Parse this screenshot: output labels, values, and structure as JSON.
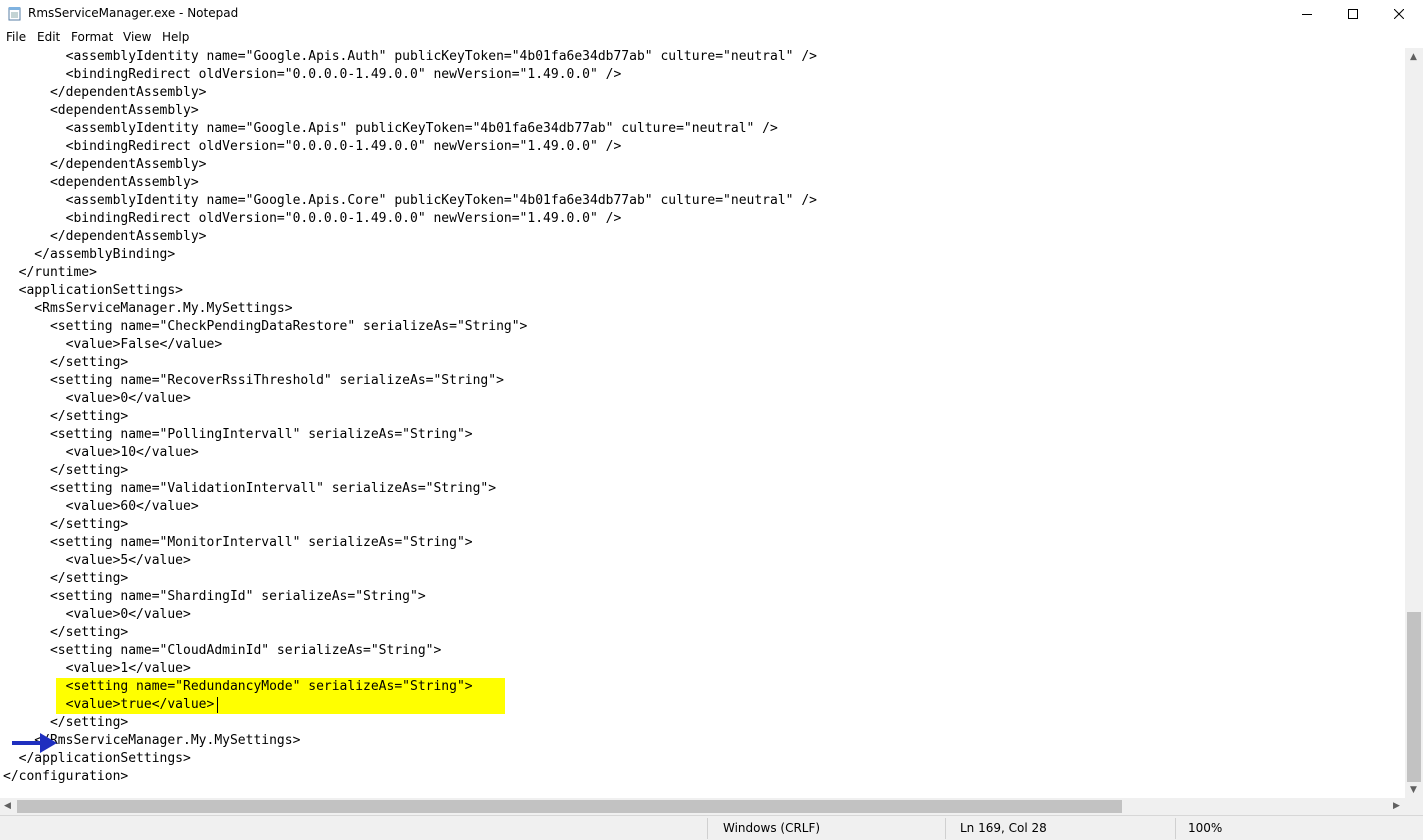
{
  "window": {
    "title": "RmsServiceManager.exe - Notepad",
    "controls": {
      "minimize": "minimize",
      "maximize": "maximize",
      "close": "close"
    }
  },
  "menu": [
    "File",
    "Edit",
    "Format",
    "View",
    "Help"
  ],
  "editor": {
    "lines": [
      "        <assemblyIdentity name=\"Google.Apis.Auth\" publicKeyToken=\"4b01fa6e34db77ab\" culture=\"neutral\" />",
      "        <bindingRedirect oldVersion=\"0.0.0.0-1.49.0.0\" newVersion=\"1.49.0.0\" />",
      "      </dependentAssembly>",
      "      <dependentAssembly>",
      "        <assemblyIdentity name=\"Google.Apis\" publicKeyToken=\"4b01fa6e34db77ab\" culture=\"neutral\" />",
      "        <bindingRedirect oldVersion=\"0.0.0.0-1.49.0.0\" newVersion=\"1.49.0.0\" />",
      "      </dependentAssembly>",
      "      <dependentAssembly>",
      "        <assemblyIdentity name=\"Google.Apis.Core\" publicKeyToken=\"4b01fa6e34db77ab\" culture=\"neutral\" />",
      "        <bindingRedirect oldVersion=\"0.0.0.0-1.49.0.0\" newVersion=\"1.49.0.0\" />",
      "      </dependentAssembly>",
      "    </assemblyBinding>",
      "  </runtime>",
      "  <applicationSettings>",
      "    <RmsServiceManager.My.MySettings>",
      "      <setting name=\"CheckPendingDataRestore\" serializeAs=\"String\">",
      "        <value>False</value>",
      "      </setting>",
      "      <setting name=\"RecoverRssiThreshold\" serializeAs=\"String\">",
      "        <value>0</value>",
      "      </setting>",
      "      <setting name=\"PollingIntervall\" serializeAs=\"String\">",
      "        <value>10</value>",
      "      </setting>",
      "      <setting name=\"ValidationIntervall\" serializeAs=\"String\">",
      "        <value>60</value>",
      "      </setting>",
      "      <setting name=\"MonitorIntervall\" serializeAs=\"String\">",
      "        <value>5</value>",
      "      </setting>",
      "      <setting name=\"ShardingId\" serializeAs=\"String\">",
      "        <value>0</value>",
      "      </setting>",
      "      <setting name=\"CloudAdminId\" serializeAs=\"String\">",
      "        <value>1</value>",
      "        <setting name=\"RedundancyMode\" serializeAs=\"String\">",
      "        <value>true</value>",
      "      </setting>",
      "    </RmsServiceManager.My.MySettings>",
      "  </applicationSettings>",
      "</configuration>"
    ],
    "highlight_color": "#ffff00",
    "arrow_color": "#1f2fbf"
  },
  "status": {
    "line_ending": "Windows (CRLF)",
    "position": "Ln 169, Col 28",
    "zoom": "100%"
  }
}
